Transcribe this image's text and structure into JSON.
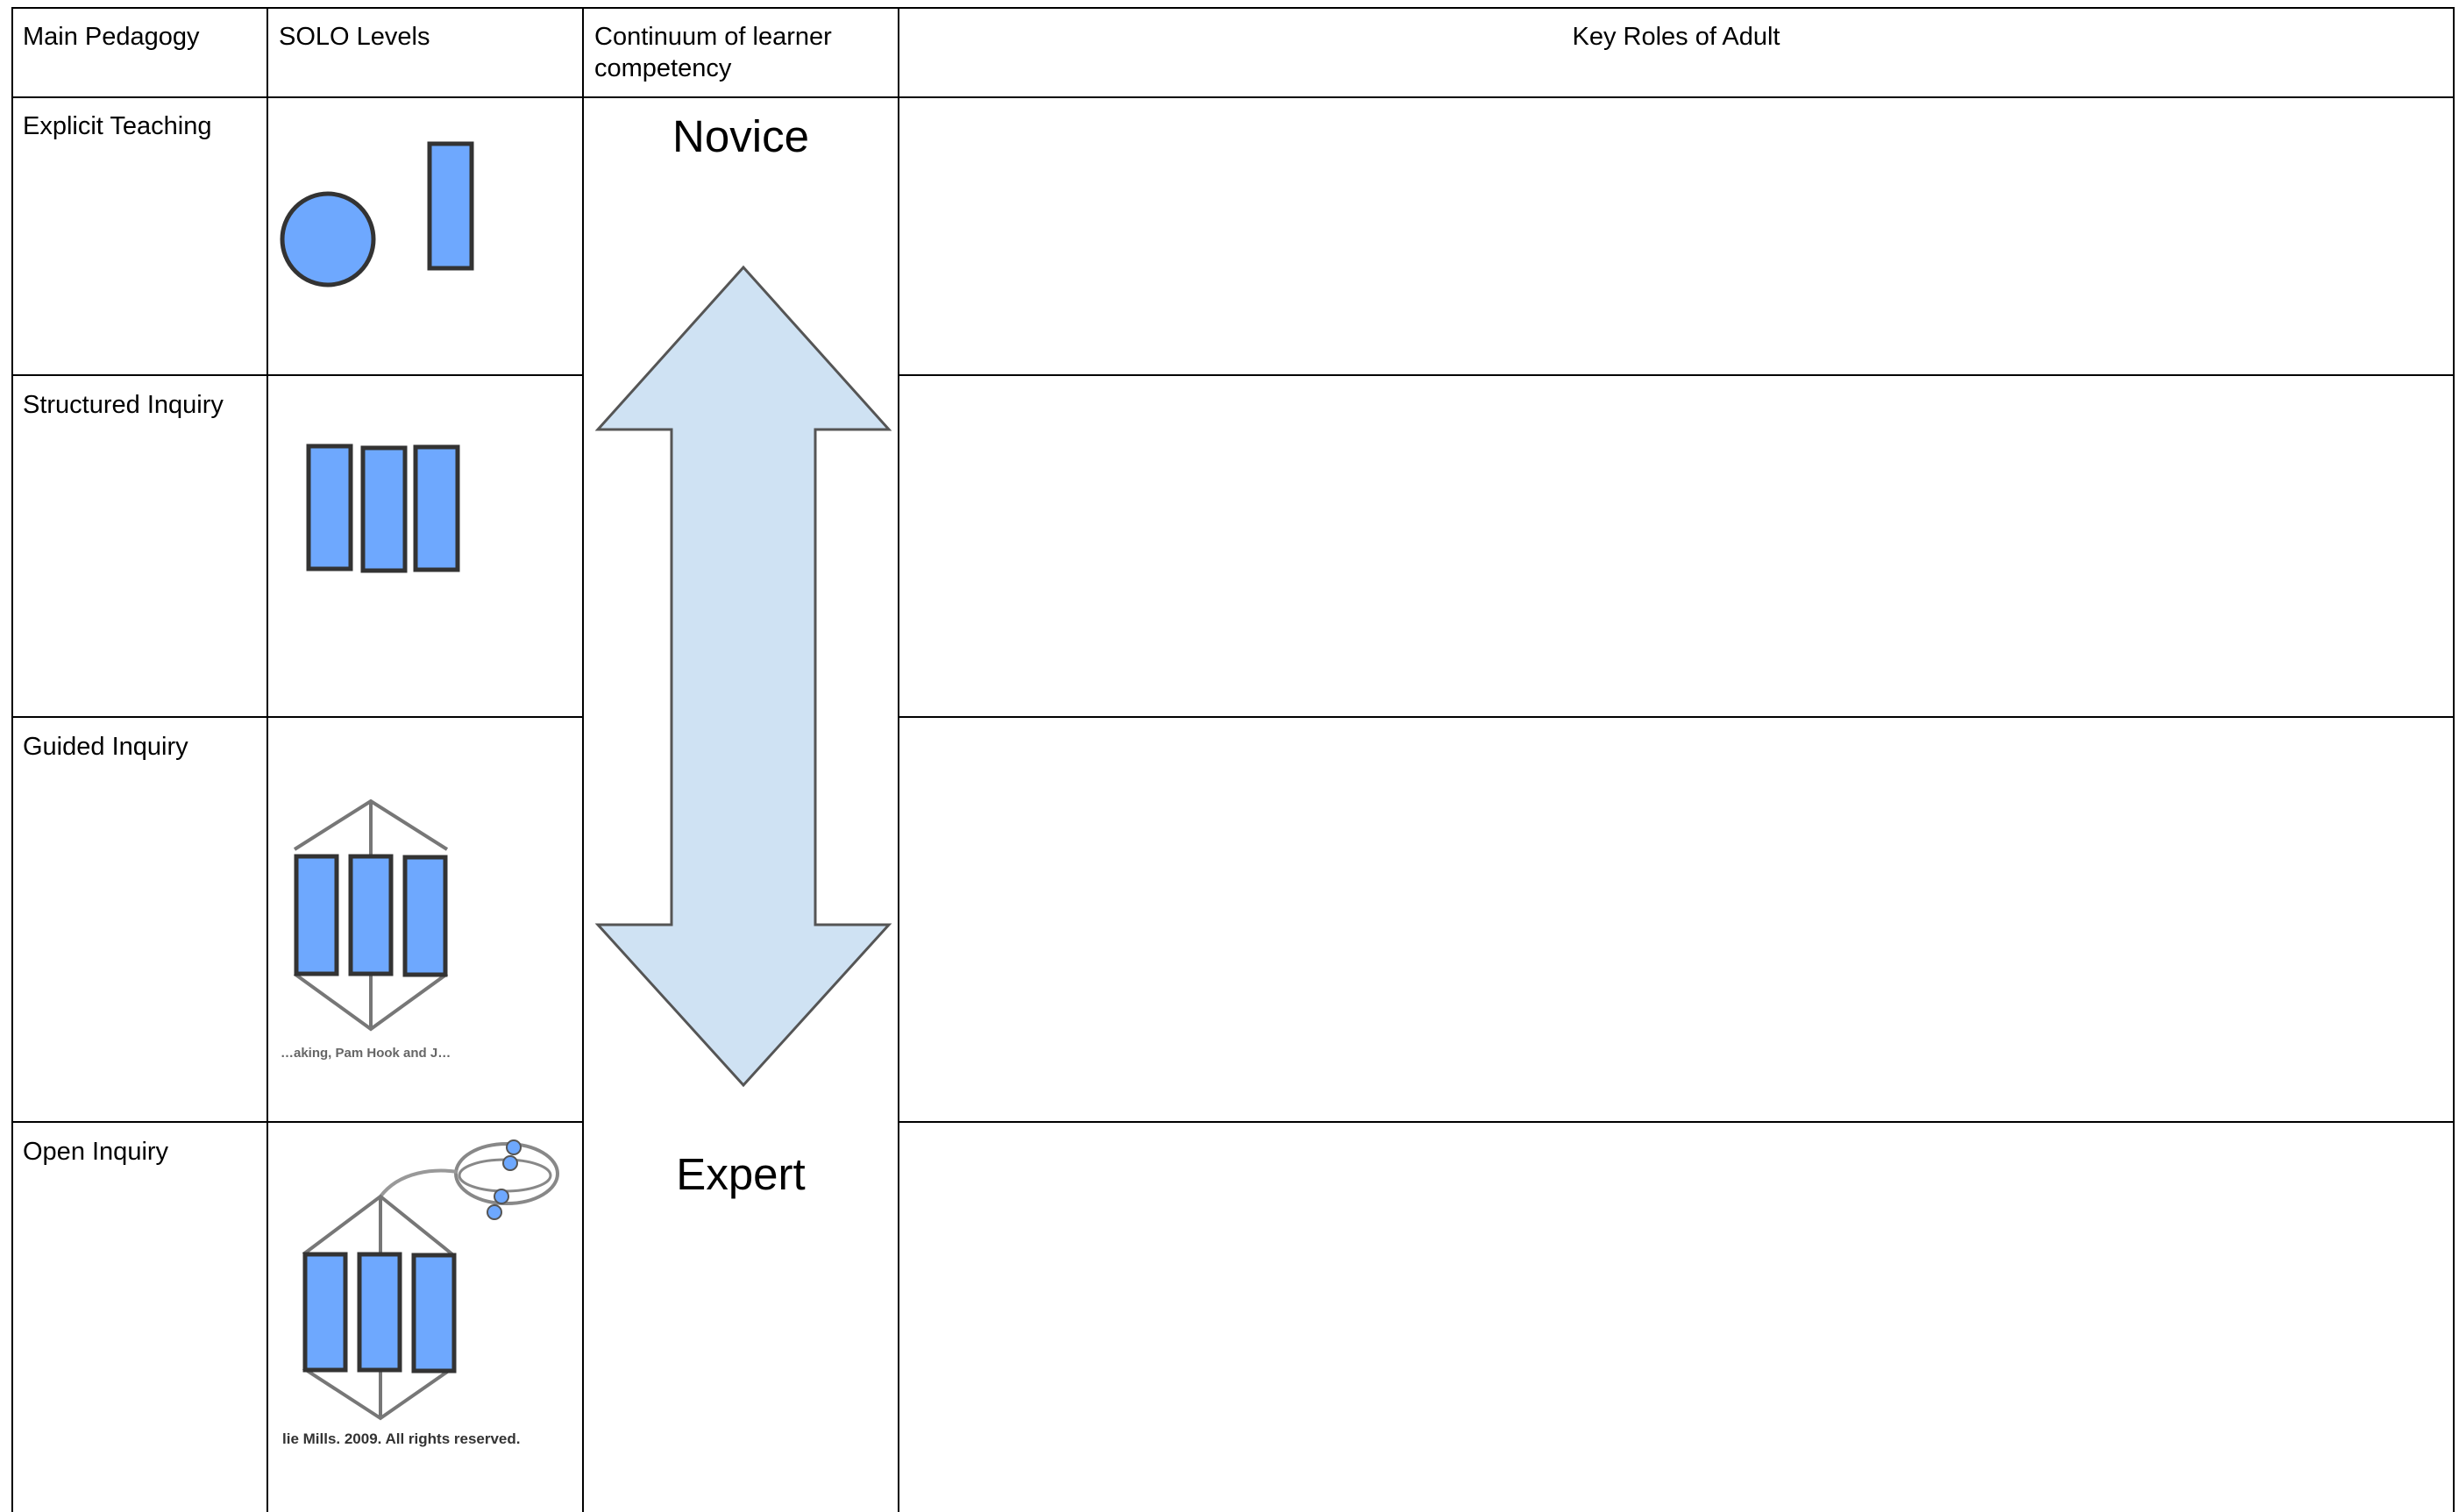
{
  "table": {
    "headers": {
      "pedagogy": "Main Pedagogy",
      "solo": "SOLO Levels",
      "continuum": "Continuum of learner competency",
      "roles": "Key Roles of Adult"
    },
    "rows": [
      {
        "pedagogy": "Explicit Teaching",
        "solo_icon": "solo-unistructural-icon",
        "roles": ""
      },
      {
        "pedagogy": "Structured Inquiry",
        "solo_icon": "solo-multistructural-icon",
        "roles": ""
      },
      {
        "pedagogy": "Guided Inquiry",
        "solo_icon": "solo-relational-icon",
        "roles": ""
      },
      {
        "pedagogy": "Open Inquiry",
        "solo_icon": "solo-extended-abstract-icon",
        "roles": ""
      }
    ]
  },
  "continuum": {
    "top_label": "Novice",
    "bottom_label": "Expert",
    "arrow_icon": "double-headed-arrow-icon",
    "arrow_fill": "#cfe2f3"
  },
  "solo_images": {
    "fill_color": "#6ea8fe",
    "credit_partial": "…aking, Pam Hook and J…",
    "credit_text": "lie Mills. 2009.  All rights reserved."
  }
}
